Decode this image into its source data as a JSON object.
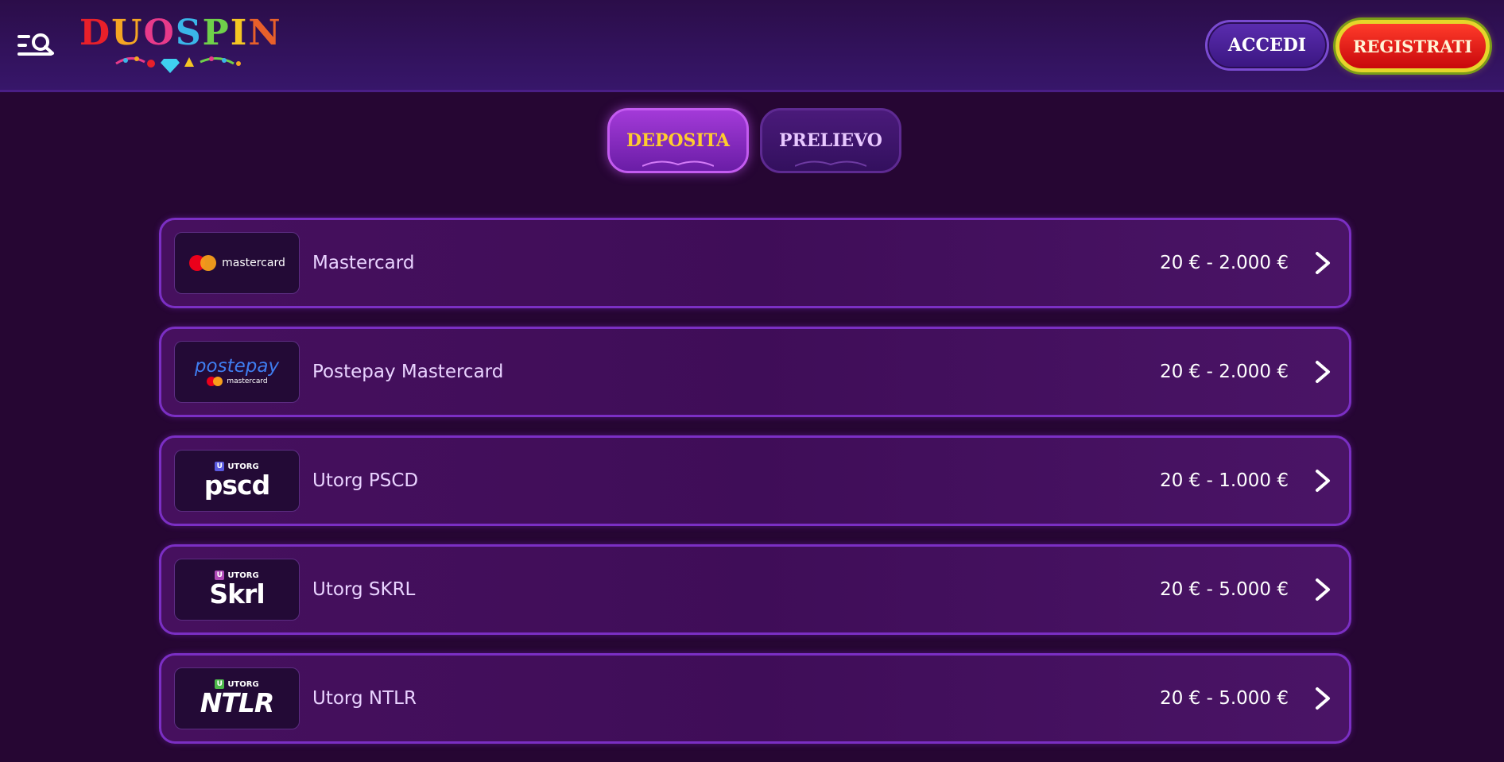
{
  "header": {
    "logo_text": "DUOSPIN",
    "login_label": "ACCEDI",
    "register_label": "REGISTRATI",
    "menu_icon": "menu-search-icon"
  },
  "tabs": [
    {
      "label": "DEPOSITA",
      "active": true
    },
    {
      "label": "PRELIEVO",
      "active": false
    }
  ],
  "methods": [
    {
      "name": "Mastercard",
      "range": "20 € - 2.000 €",
      "logo_text": "mastercard"
    },
    {
      "name": "Postepay Mastercard",
      "range": "20 € - 2.000 €",
      "logo_text": "postepay",
      "logo_sub": "mastercard"
    },
    {
      "name": "Utorg PSCD",
      "range": "20 € - 1.000 €",
      "logo_top": "UTORG",
      "logo_badge": "U",
      "logo_text": "pscd"
    },
    {
      "name": "Utorg SKRL",
      "range": "20 € - 5.000 €",
      "logo_top": "UTORG",
      "logo_badge": "U",
      "logo_text": "Skrl"
    },
    {
      "name": "Utorg NTLR",
      "range": "20 € - 5.000 €",
      "logo_top": "UTORG",
      "logo_badge": "U",
      "logo_text": "NTLR"
    }
  ],
  "colors": {
    "background": "#260633",
    "accent_purple": "#7b2fc4",
    "active_tab_text": "#ffcc2e",
    "register_red": "#e0201a",
    "register_border": "#e6d52a",
    "utorg_pscd_badge": "#5a5ae0",
    "utorg_skrl_badge": "#b04ab8",
    "utorg_ntlr_badge": "#4cb84a"
  }
}
